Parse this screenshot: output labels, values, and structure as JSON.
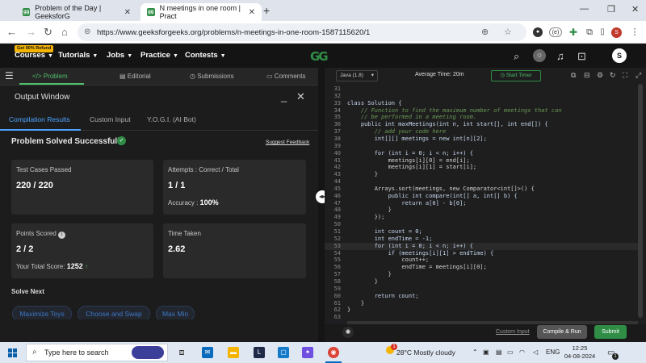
{
  "browser": {
    "tabs": [
      {
        "title": "Problem of the Day | GeeksforG"
      },
      {
        "title": "N meetings in one room | Pract"
      }
    ],
    "new_tab": "+",
    "url": "https://www.geeksforgeeks.org/problems/n-meetings-in-one-room-1587115620/1",
    "profile_initial": "S",
    "ext_badge": "(e)"
  },
  "site_header": {
    "refund_badge": "Get 90% Refund",
    "nav": [
      "Courses",
      "Tutorials",
      "Jobs",
      "Practice",
      "Contests"
    ],
    "logo": "GG",
    "avatar_initial": "S"
  },
  "problem_tabs": [
    "Problem",
    "Editorial",
    "Submissions",
    "Comments"
  ],
  "output_window": {
    "title": "Output Window",
    "subtabs": [
      "Compilation Results",
      "Custom Input",
      "Y.O.G.I. (AI Bot)"
    ],
    "status": "Problem Solved Successfully",
    "suggest_feedback": "Suggest Feedback",
    "cards": {
      "test_cases": {
        "label": "Test Cases Passed",
        "value": "220 / 220"
      },
      "attempts": {
        "label": "Attempts : Correct / Total",
        "value": "1 / 1",
        "sub_label": "Accuracy :",
        "sub_value": "100%"
      },
      "points": {
        "label": "Points Scored",
        "value": "2 / 2",
        "sub_label": "Your Total Score:",
        "sub_value": "1252"
      },
      "time": {
        "label": "Time Taken",
        "value": "2.62"
      }
    },
    "solve_next_label": "Solve Next",
    "solve_next": [
      "Maximize Toys",
      "Choose and Swap",
      "Max Min"
    ]
  },
  "editor": {
    "language": "Java (1.8)",
    "average_time": "Average Time: 20m",
    "start_timer": "Start Timer",
    "custom_input": "Custom Input",
    "compile_run": "Compile & Run",
    "submit": "Submit"
  },
  "code_lines": [
    {
      "n": "31",
      "t": ""
    },
    {
      "n": "32",
      "t": ""
    },
    {
      "n": "33",
      "t": "class Solution {"
    },
    {
      "n": "34",
      "t": "    // Function to find the maximum number of meetings that can"
    },
    {
      "n": "35",
      "t": "    // be performed in a meeting room."
    },
    {
      "n": "36",
      "t": "    public int maxMeetings(int n, int start[], int end[]) {"
    },
    {
      "n": "37",
      "t": "        // add your code here"
    },
    {
      "n": "38",
      "t": "        int[][] meetings = new int[n][2];"
    },
    {
      "n": "39",
      "t": ""
    },
    {
      "n": "40",
      "t": "        for (int i = 0; i < n; i++) {"
    },
    {
      "n": "41",
      "t": "            meetings[i][0] = end[i];"
    },
    {
      "n": "42",
      "t": "            meetings[i][1] = start[i];"
    },
    {
      "n": "43",
      "t": "        }"
    },
    {
      "n": "44",
      "t": ""
    },
    {
      "n": "45",
      "t": "        Arrays.sort(meetings, new Comparator<int[]>() {"
    },
    {
      "n": "46",
      "t": "            public int compare(int[] a, int[] b) {"
    },
    {
      "n": "47",
      "t": "                return a[0] - b[0];"
    },
    {
      "n": "48",
      "t": "            }"
    },
    {
      "n": "49",
      "t": "        });"
    },
    {
      "n": "50",
      "t": ""
    },
    {
      "n": "51",
      "t": "        int count = 0;"
    },
    {
      "n": "52",
      "t": "        int endTime = -1;"
    },
    {
      "n": "53",
      "t": "        for (int i = 0; i < n; i++) {"
    },
    {
      "n": "54",
      "t": "            if (meetings[i][1] > endTime) {"
    },
    {
      "n": "55",
      "t": "                count++;"
    },
    {
      "n": "56",
      "t": "                endTime = meetings[i][0];"
    },
    {
      "n": "57",
      "t": "            }"
    },
    {
      "n": "58",
      "t": "        }"
    },
    {
      "n": "59",
      "t": ""
    },
    {
      "n": "60",
      "t": "        return count;"
    },
    {
      "n": "61",
      "t": "    }"
    },
    {
      "n": "62",
      "t": "}"
    },
    {
      "n": "63",
      "t": ""
    }
  ],
  "taskbar": {
    "search_placeholder": "Type here to search",
    "temperature": "28°C",
    "weather": "Mostly cloudy",
    "lang": "ENG",
    "time": "12:25",
    "date": "04-08-2024",
    "notif_count": "1",
    "weather_badge": "1"
  },
  "colors": {
    "brand_green": "#2f8d46",
    "link_blue": "#4da3ff"
  }
}
